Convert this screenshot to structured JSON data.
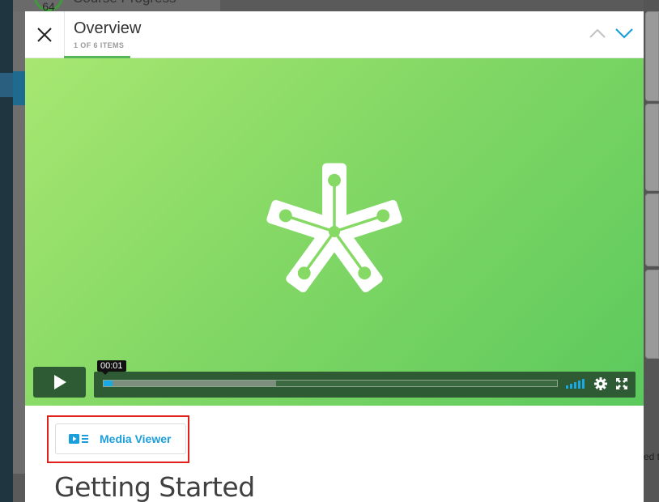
{
  "background": {
    "course_score": "64",
    "course_title_fragment": "Course Progress",
    "right_fragment": "ed t"
  },
  "header": {
    "title": "Overview",
    "subtitle": "1 OF 6 ITEMS"
  },
  "icons": {
    "close": "close-icon",
    "up": "chevron-up-icon",
    "down": "chevron-down-icon",
    "play": "play-icon",
    "volume": "volume-icon",
    "settings": "gear-icon",
    "fullscreen": "fullscreen-icon",
    "media": "media-viewer-icon"
  },
  "player": {
    "time_tooltip": "00:01",
    "progress": 0.02,
    "buffered": 0.38
  },
  "media_viewer": {
    "label": "Media Viewer"
  },
  "content": {
    "section_title": "Getting Started"
  },
  "colors": {
    "accent_blue": "#1b9fdc",
    "accent_green": "#58b55a",
    "highlight_red": "#e0201a"
  }
}
